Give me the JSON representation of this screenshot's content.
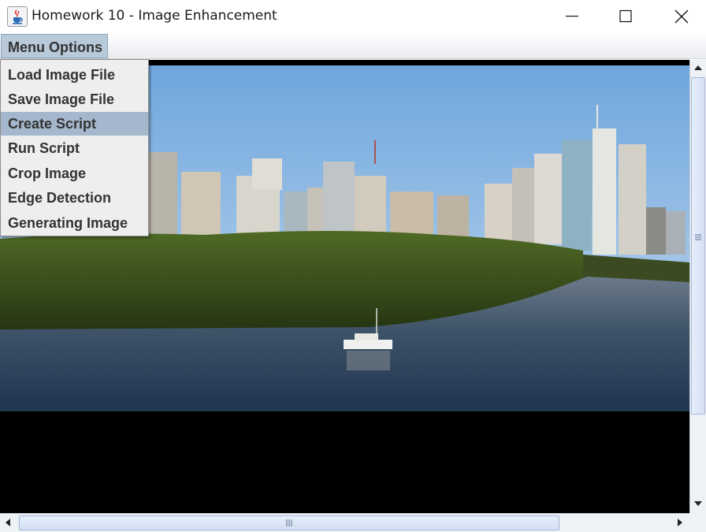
{
  "window": {
    "title": "Homework 10 - Image Enhancement",
    "icon": "java-cup-icon",
    "controls": [
      "minimize-icon",
      "maximize-icon",
      "close-icon"
    ]
  },
  "menubar": {
    "menu_label": "Menu Options"
  },
  "menu": {
    "items": [
      {
        "label": "Load Image File"
      },
      {
        "label": "Save Image File"
      },
      {
        "label": "Create Script",
        "highlighted": true
      },
      {
        "label": "Run Script"
      },
      {
        "label": "Crop Image"
      },
      {
        "label": "Edge Detection"
      },
      {
        "label": "Generating Image"
      }
    ]
  },
  "colors": {
    "menu_highlight": "#a4b7cc",
    "menubar_selected": "#b8c9da",
    "canvas_background": "#000000"
  }
}
